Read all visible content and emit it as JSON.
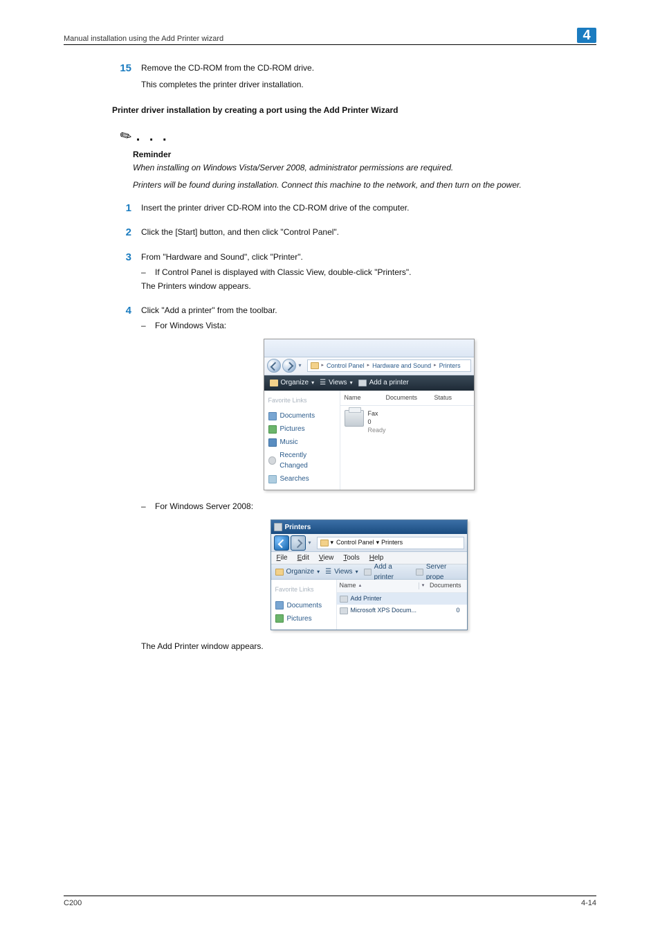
{
  "header": {
    "left": "Manual installation using the Add Printer wizard",
    "right": "4"
  },
  "step15": {
    "num": "15",
    "line1": "Remove the CD-ROM from the CD-ROM drive.",
    "line2": "This completes the printer driver installation."
  },
  "section_heading": "Printer driver installation by creating a port using the Add Printer Wizard",
  "note": {
    "dots": ". . .",
    "title": "Reminder",
    "p1": "When installing on Windows Vista/Server 2008, administrator permissions are required.",
    "p2": "Printers will be found during installation. Connect this machine to the network, and then turn on the power."
  },
  "steps": {
    "s1": {
      "num": "1",
      "text": "Insert the printer driver CD-ROM into the CD-ROM drive of the computer."
    },
    "s2": {
      "num": "2",
      "text": "Click the [Start] button, and then click \"Control Panel\"."
    },
    "s3": {
      "num": "3",
      "text": "From \"Hardware and Sound\", click \"Printer\".",
      "dash": "–",
      "sub1": "If Control Panel is displayed with Classic View, double-click \"Printers\".",
      "tail": "The Printers window appears."
    },
    "s4": {
      "num": "4",
      "text": "Click \"Add a printer\" from the toolbar.",
      "dash1": "–",
      "sub1": "For Windows Vista:",
      "dash2": "–",
      "sub2": "For Windows Server 2008:"
    }
  },
  "vista": {
    "path": {
      "a": "Control Panel",
      "b": "Hardware and Sound",
      "c": "Printers"
    },
    "toolbar": {
      "organize": "Organize",
      "views": "Views",
      "add": "Add a printer"
    },
    "side_head": "Favorite Links",
    "links": {
      "docs": "Documents",
      "pics": "Pictures",
      "music": "Music",
      "recent": "Recently Changed",
      "search": "Searches"
    },
    "cols": {
      "name": "Name",
      "docs": "Documents",
      "status": "Status"
    },
    "printer": {
      "name": "Fax",
      "count": "0",
      "state": "Ready"
    }
  },
  "s2008": {
    "title": "Printers",
    "path": {
      "a": "Control Panel",
      "b": "Printers"
    },
    "menu": {
      "file": "File",
      "edit": "Edit",
      "view": "View",
      "tools": "Tools",
      "help": "Help"
    },
    "toolbar": {
      "organize": "Organize",
      "views": "Views",
      "add": "Add a printer",
      "server": "Server prope"
    },
    "side_head": "Favorite Links",
    "links": {
      "docs": "Documents",
      "pics": "Pictures"
    },
    "cols": {
      "name": "Name",
      "docs": "Documents"
    },
    "rows": {
      "r1": "Add Printer",
      "r2": "Microsoft XPS Docum...",
      "r2c": "0"
    }
  },
  "after_shots": "The Add Printer window appears.",
  "footer": {
    "left": "C200",
    "right": "4-14"
  }
}
